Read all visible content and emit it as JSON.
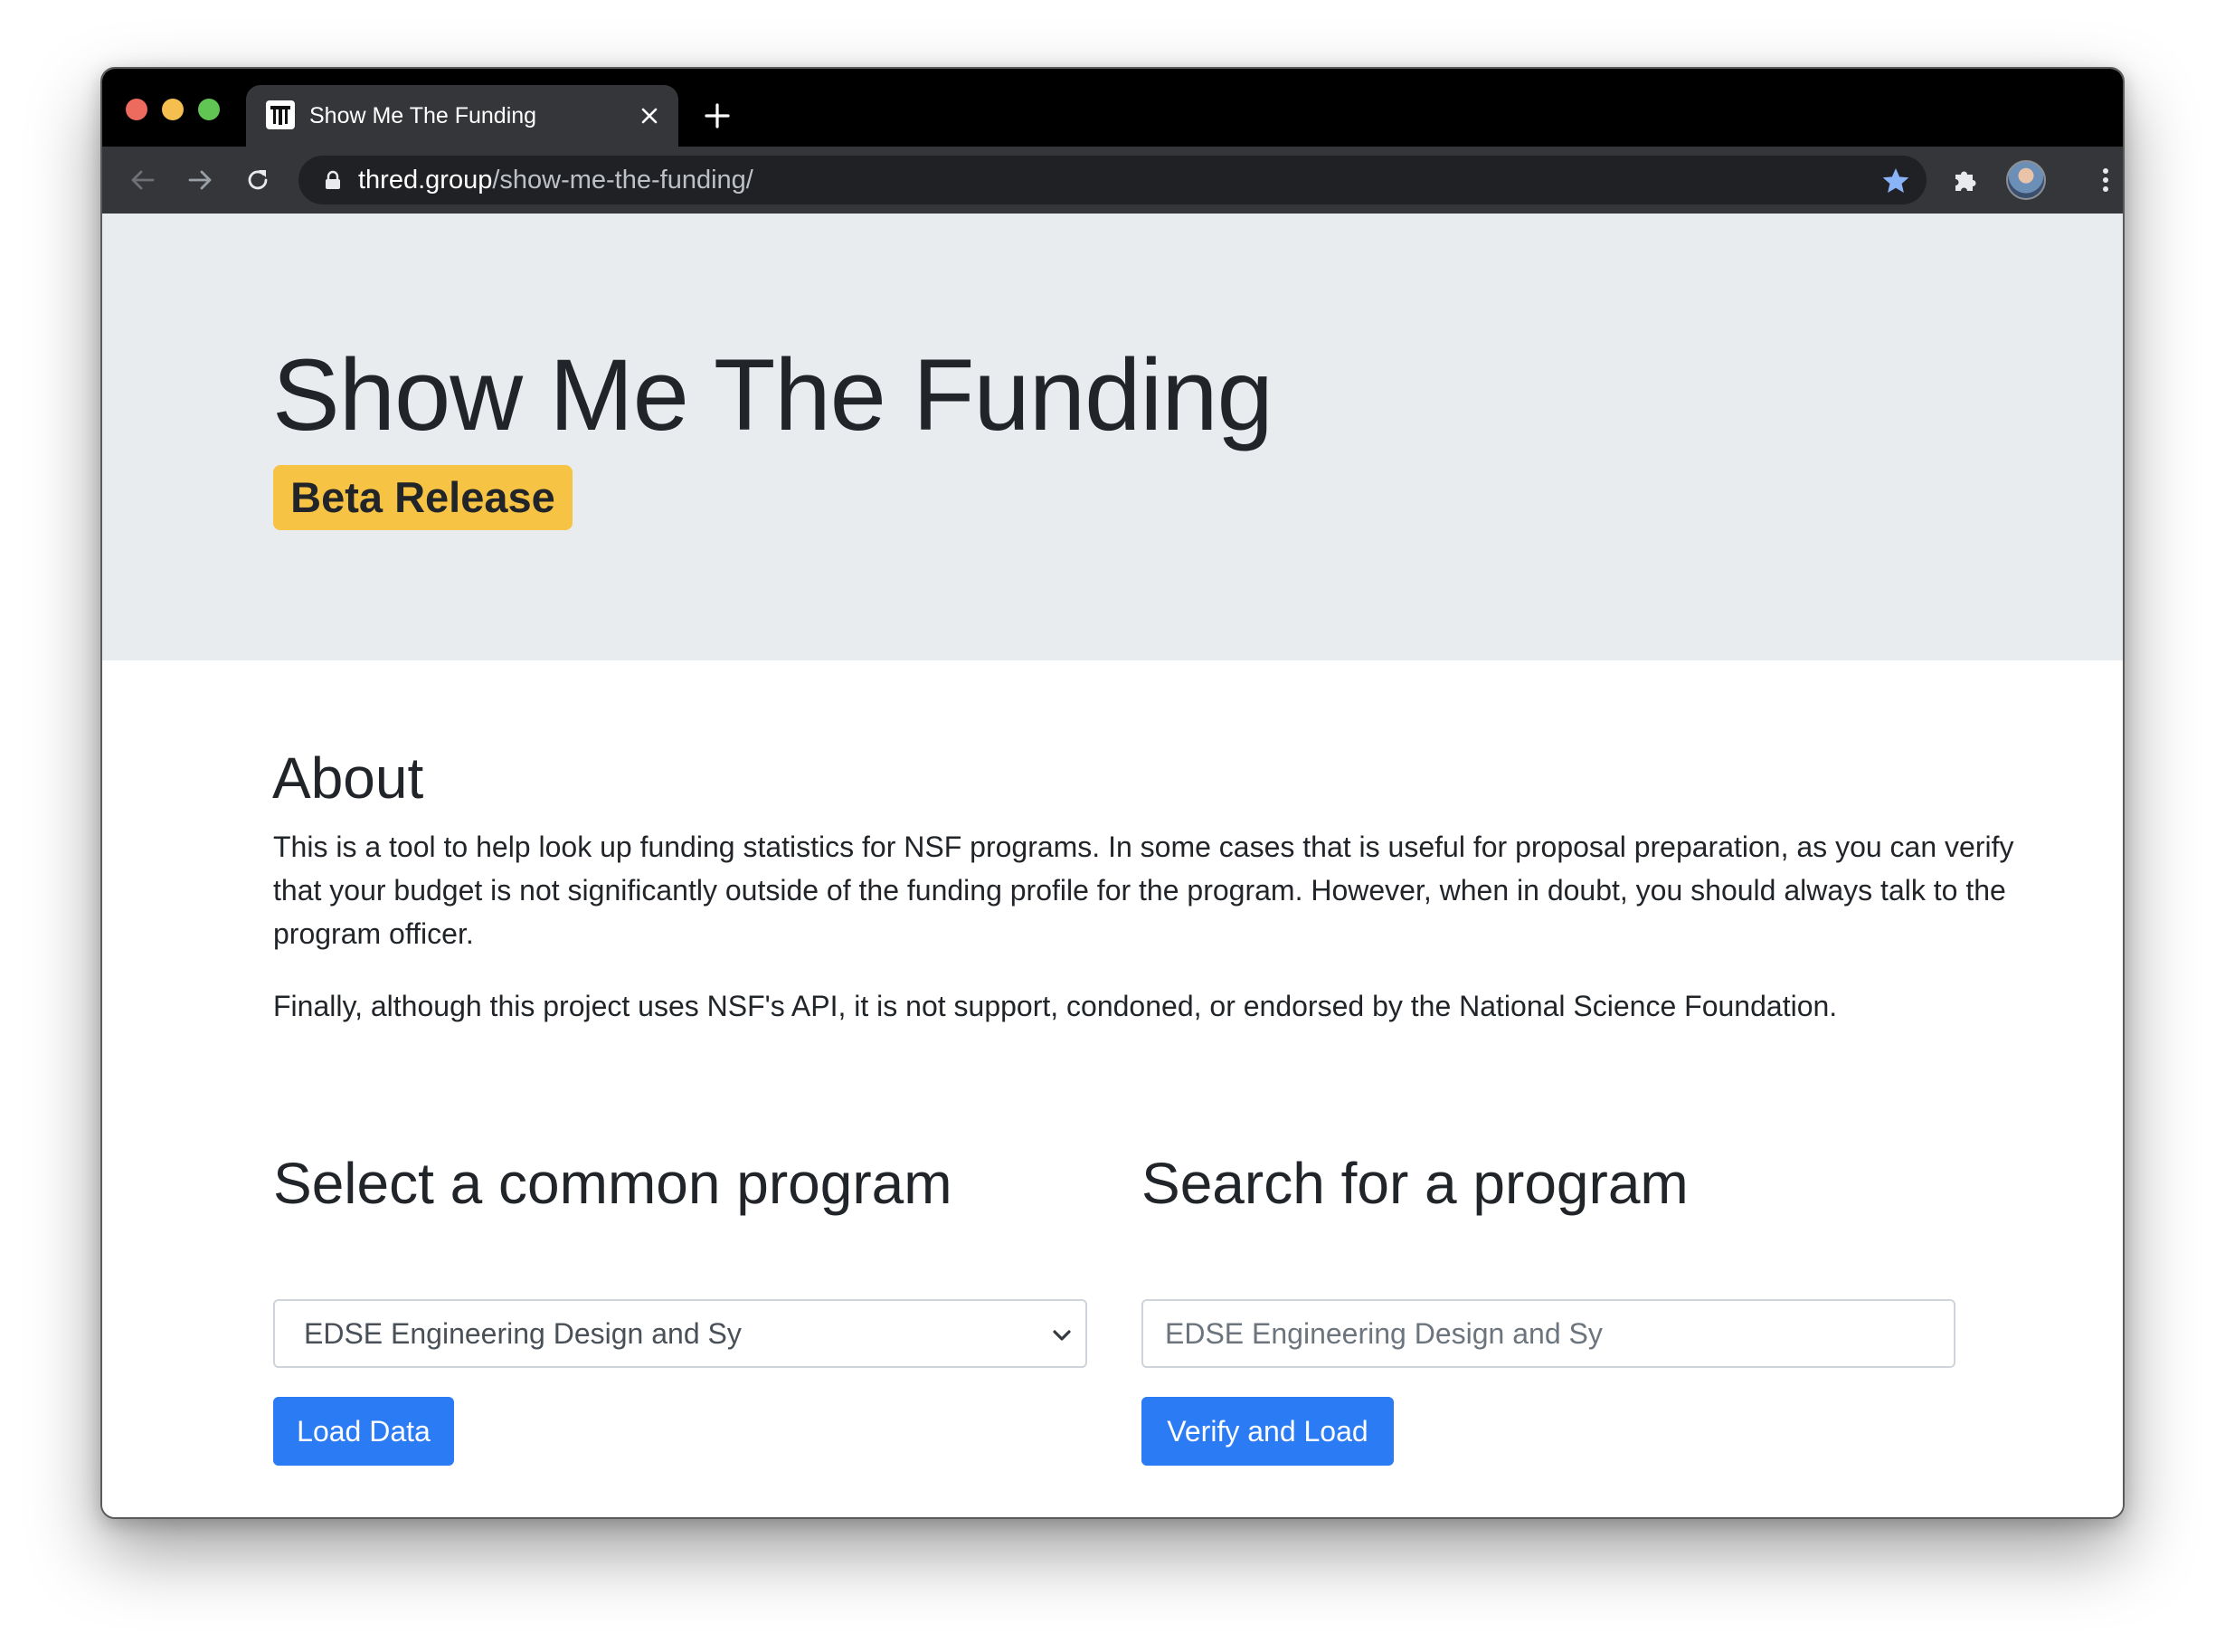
{
  "browser": {
    "tab_title": "Show Me The Funding",
    "url_host": "thred.group",
    "url_path": "/show-me-the-funding/"
  },
  "hero": {
    "title": "Show Me The Funding",
    "badge": "Beta Release"
  },
  "about": {
    "heading": "About",
    "paragraph1": "This is a tool to help look up funding statistics for NSF programs. In some cases that is useful for proposal preparation, as you can verify that your budget is not significantly outside of the funding profile for the program. However, when in doubt, you should always talk to the program officer.",
    "paragraph2": "Finally, although this project uses NSF's API, it is not support, condoned, or endorsed by the National Science Foundation."
  },
  "select_section": {
    "heading": "Select a common program",
    "selected_value": "EDSE Engineering Design and Sy",
    "button_label": "Load Data"
  },
  "search_section": {
    "heading": "Search for a program",
    "placeholder": "EDSE Engineering Design and Sy",
    "button_label": "Verify and Load"
  },
  "colors": {
    "badge": "#f6c344",
    "primary_button": "#2b7bf4",
    "jumbotron": "#e9ecef",
    "bookmark_star": "#8ab4f8"
  }
}
